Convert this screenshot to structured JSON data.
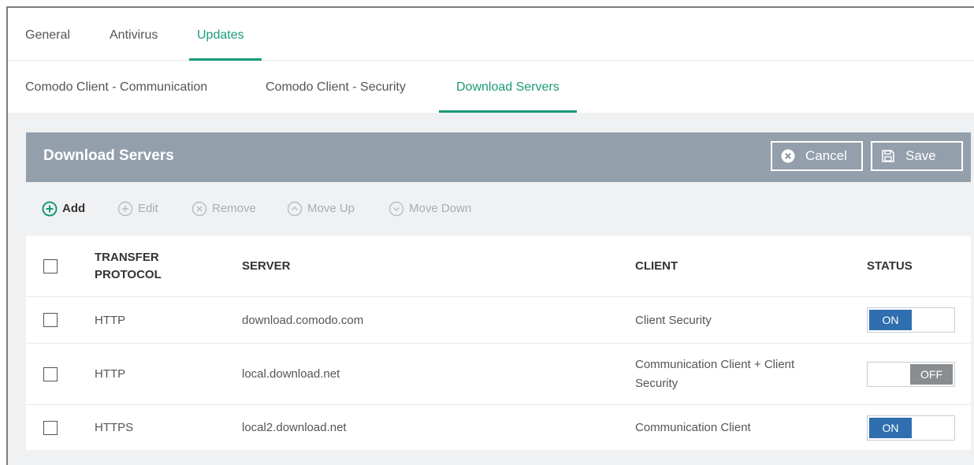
{
  "tabs": [
    "General",
    "Antivirus",
    "Updates"
  ],
  "subtabs": [
    "Comodo Client - Communication",
    "Comodo Client - Security",
    "Download Servers"
  ],
  "panel": {
    "title": "Download Servers",
    "cancel_label": "Cancel",
    "save_label": "Save"
  },
  "toolbar": {
    "add": "Add",
    "edit": "Edit",
    "remove": "Remove",
    "move_up": "Move Up",
    "move_down": "Move Down"
  },
  "table": {
    "headers": {
      "protocol_line1": "TRANSFER",
      "protocol_line2": "PROTOCOL",
      "server": "SERVER",
      "client": "CLIENT",
      "status": "STATUS"
    },
    "rows": [
      {
        "protocol": "HTTP",
        "server": "download.comodo.com",
        "client": "Client Security",
        "status": "ON"
      },
      {
        "protocol": "HTTP",
        "server": "local.download.net",
        "client_line1": "Communication Client + Client",
        "client_line2": "Security",
        "status": "OFF"
      },
      {
        "protocol": "HTTPS",
        "server": "local2.download.net",
        "client": "Communication Client",
        "status": "ON"
      }
    ]
  },
  "colors": {
    "accent": "#1a9a78",
    "header_bg": "#939fab",
    "toggle_on": "#2f6fb0",
    "toggle_off": "#8a8d90"
  }
}
